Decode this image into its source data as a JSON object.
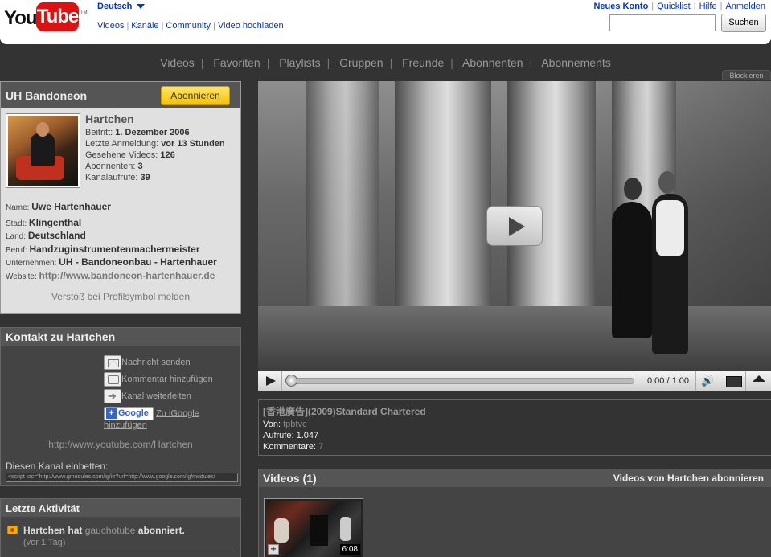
{
  "header": {
    "logo_you": "You",
    "logo_tube": "Tube",
    "logo_tm": "TM",
    "language": "Deutsch",
    "nav": [
      "Videos",
      "Kanäle",
      "Community",
      "Video hochladen"
    ],
    "account_links": [
      "Neues Konto",
      "Quicklist",
      "Hilfe",
      "Anmelden"
    ],
    "search_placeholder": "",
    "search_button": "Suchen"
  },
  "channel_nav": {
    "items": [
      "Videos",
      "Favoriten",
      "Playlists",
      "Gruppen",
      "Freunde",
      "Abonnenten",
      "Abonnements"
    ],
    "block": "Blockieren"
  },
  "profile": {
    "title": "UH Bandoneon",
    "subscribe": "Abonnieren",
    "username": "Hartchen",
    "stats": [
      {
        "label": "Beitritt:",
        "value": "1. Dezember 2006"
      },
      {
        "label": "Letzte Anmeldung:",
        "value": "vor 13 Stunden"
      },
      {
        "label": "Gesehene Videos:",
        "value": "126"
      },
      {
        "label": "Abonnenten:",
        "value": "3"
      },
      {
        "label": "Kanalaufrufe:",
        "value": "39"
      }
    ],
    "info": [
      {
        "label": "Name:",
        "value": "Uwe Hartenhauer"
      },
      {
        "label": "Stadt:",
        "value": "Klingenthal"
      },
      {
        "label": "Land:",
        "value": "Deutschland"
      },
      {
        "label": "Beruf:",
        "value": "Handzuginstrumentenmachermeister"
      },
      {
        "label": "Unternehmen:",
        "value": "UH - Bandoneonbau - Hartenhauer"
      },
      {
        "label": "Website:",
        "value": "http://www.bandoneon-hartenhauer.de"
      }
    ],
    "report": "Verstoß bei Profilsymbol melden"
  },
  "contact": {
    "title": "Kontakt zu Hartchen",
    "send_message": "Nachricht senden",
    "add_comment": "Kommentar hinzufügen",
    "forward_channel": "Kanal weiterleiten",
    "igoogle_btn": "Google",
    "igoogle_link_1": "Zu iGoogle",
    "igoogle_link_2": "hinzufügen",
    "channel_url": "http://www.youtube.com/Hartchen",
    "embed_label": "Diesen Kanal einbetten:",
    "embed_code": "<script src=\"http://www.gmodules.com/ig/ifr?url=http://www.google.com/ig/modules/"
  },
  "activity": {
    "title": "Letzte Aktivität",
    "user": "Hartchen",
    "verb": "hat",
    "target": "gauchotube",
    "action": "abonniert.",
    "time": "(vor 1 Tag)"
  },
  "player": {
    "time": "0:00 / 1:00",
    "progress": 0
  },
  "video_info": {
    "title": "[香港廣告](2009)Standard Chartered",
    "from_label": "Von:",
    "from_value": "tpbtvc",
    "views_label": "Aufrufe:",
    "views_value": "1.047",
    "comments_label": "Kommentare:",
    "comments_value": "7"
  },
  "videos": {
    "title": "Videos (1)",
    "subscribe_link": "Videos von Hartchen abonnieren",
    "thumb_duration": "6:08",
    "thumb_add": "+"
  }
}
